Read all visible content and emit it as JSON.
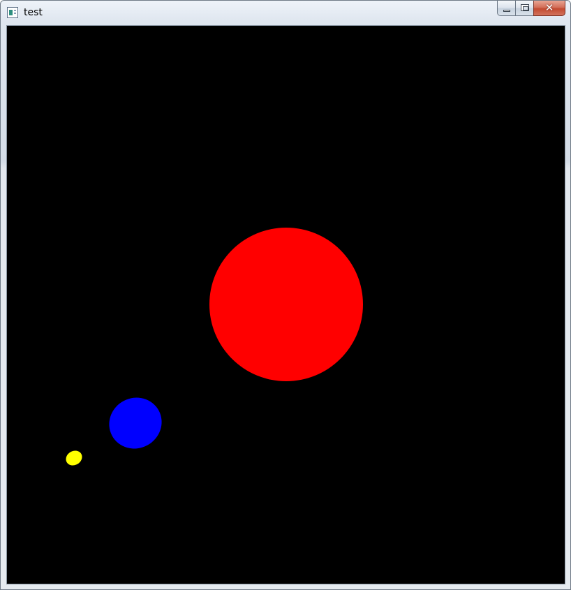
{
  "window": {
    "title": "test",
    "close_glyph": "✕"
  },
  "icons": {
    "app_icon": "window-app-icon",
    "minimize": "minimize-icon",
    "maximize": "maximize-icon",
    "close": "close-icon"
  },
  "scene": {
    "background_color": "#000000",
    "bodies": [
      {
        "name": "red-circle",
        "color": "#ff0000"
      },
      {
        "name": "blue-ellipse",
        "color": "#0000ff"
      },
      {
        "name": "yellow-ellipse",
        "color": "#ffff00"
      }
    ]
  }
}
